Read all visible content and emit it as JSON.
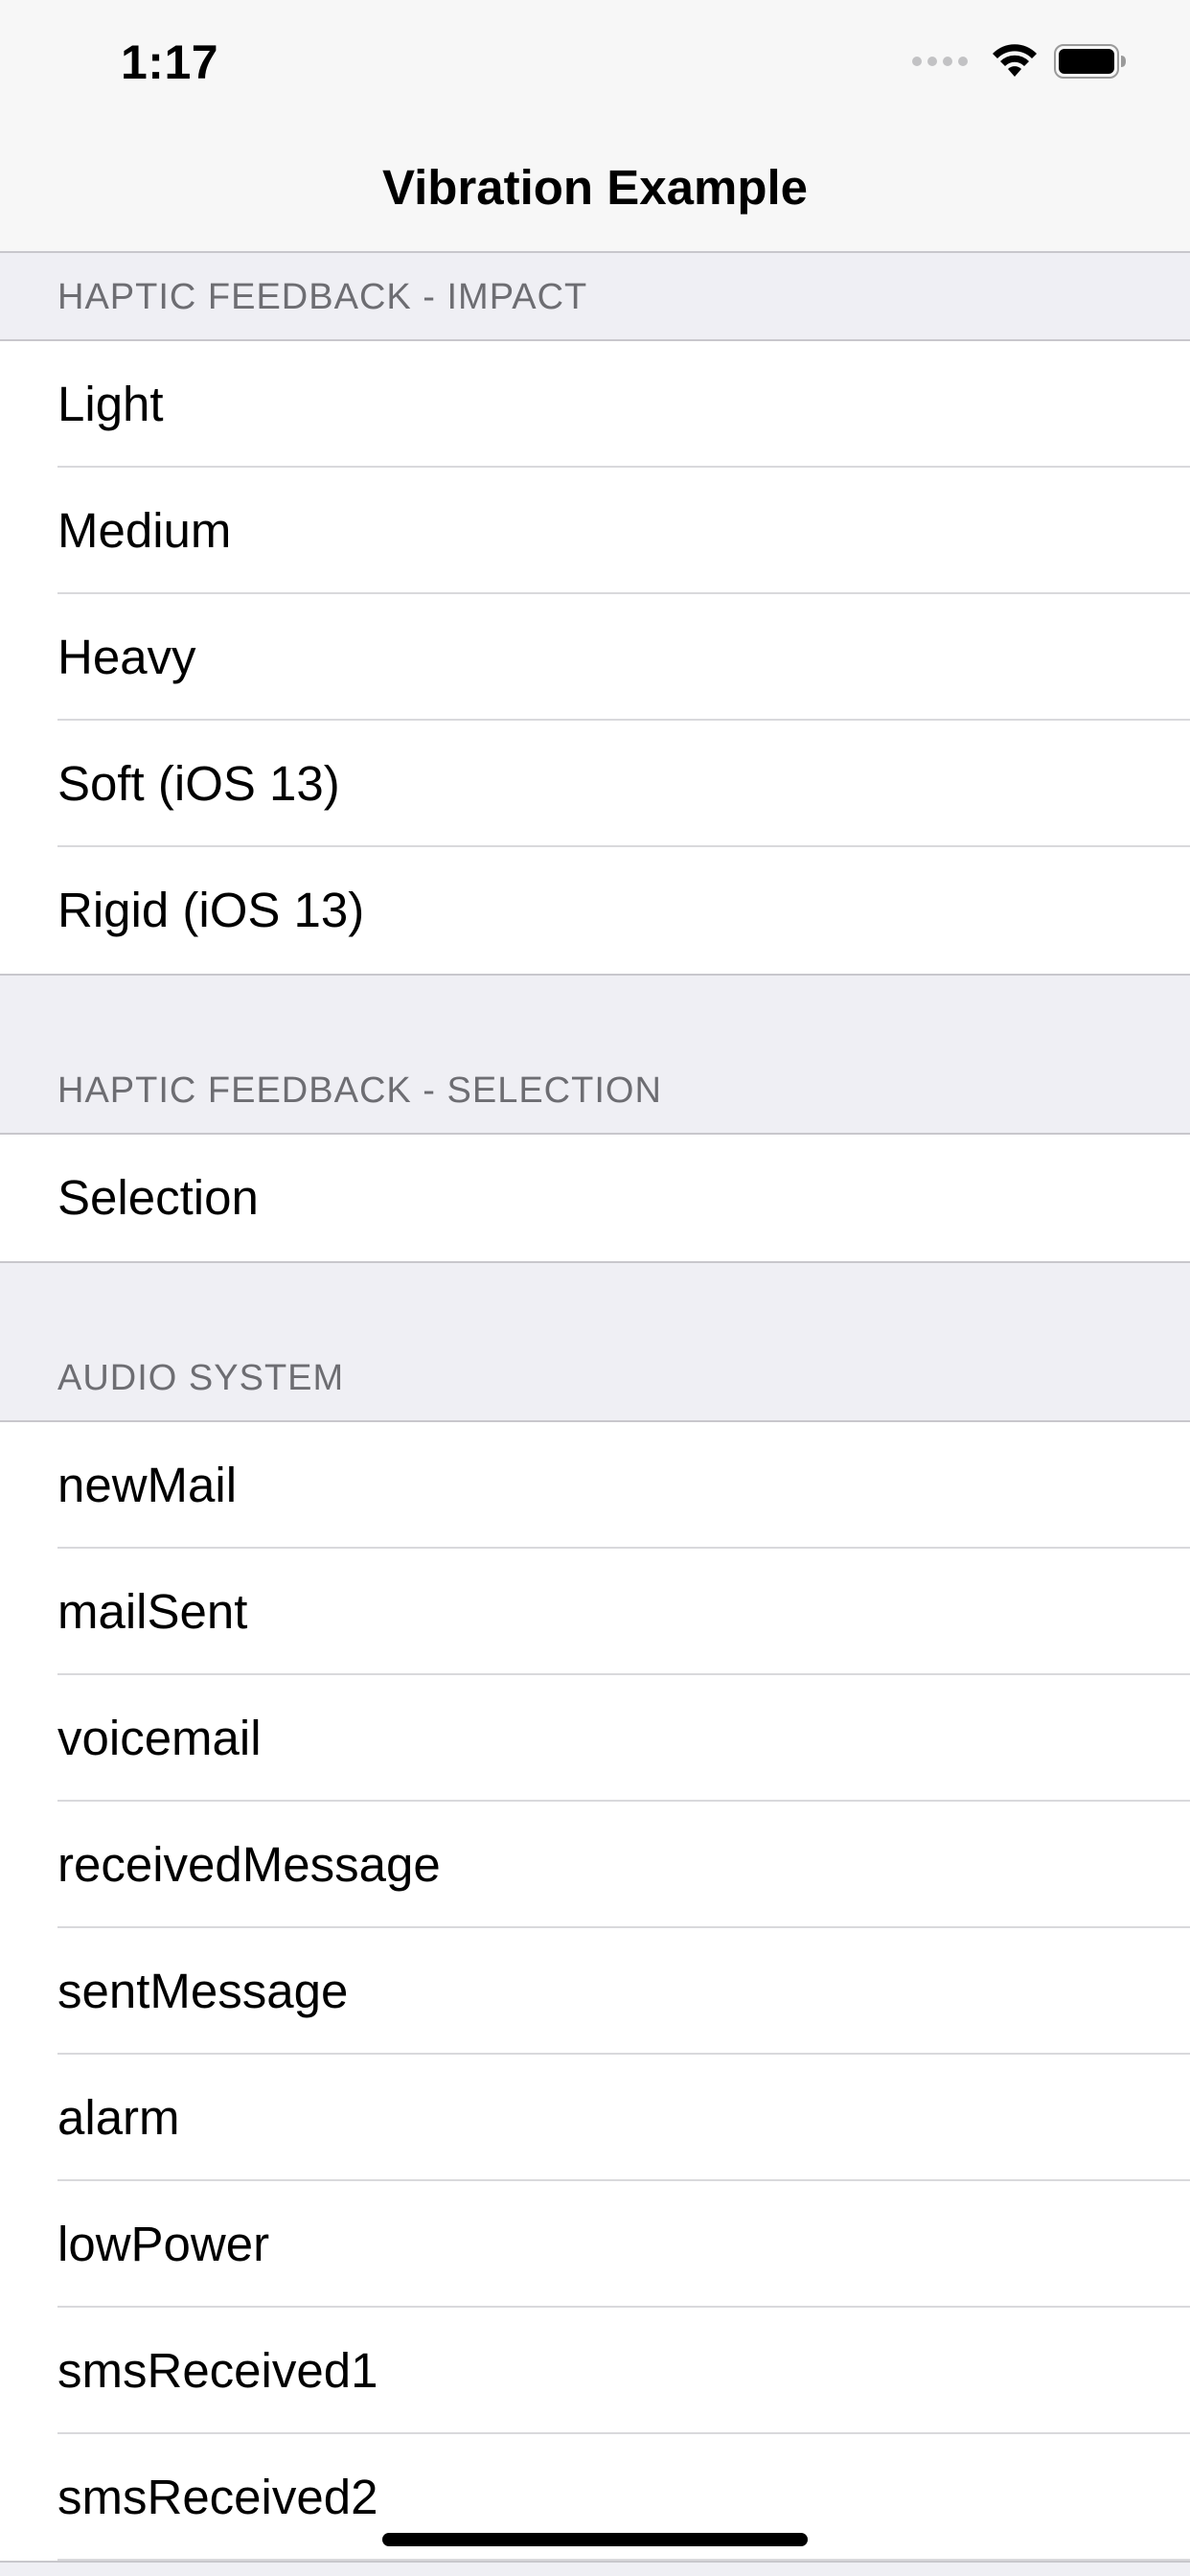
{
  "status_bar": {
    "time": "1:17",
    "icons": [
      "signal-dots-icon",
      "wifi-icon",
      "battery-icon"
    ]
  },
  "nav": {
    "title": "Vibration Example"
  },
  "sections": [
    {
      "header": "HAPTIC FEEDBACK - IMPACT",
      "items": [
        "Light",
        "Medium",
        "Heavy",
        "Soft (iOS 13)",
        "Rigid (iOS 13)"
      ]
    },
    {
      "header": "HAPTIC FEEDBACK - SELECTION",
      "items": [
        "Selection"
      ]
    },
    {
      "header": "AUDIO SYSTEM",
      "items": [
        "newMail",
        "mailSent",
        "voicemail",
        "receivedMessage",
        "sentMessage",
        "alarm",
        "lowPower",
        "smsReceived1",
        "smsReceived2"
      ]
    }
  ],
  "colors": {
    "background": "#efeff4",
    "header_text": "#6d6d72",
    "separator": "#c8c7cc",
    "row_background": "#ffffff"
  }
}
